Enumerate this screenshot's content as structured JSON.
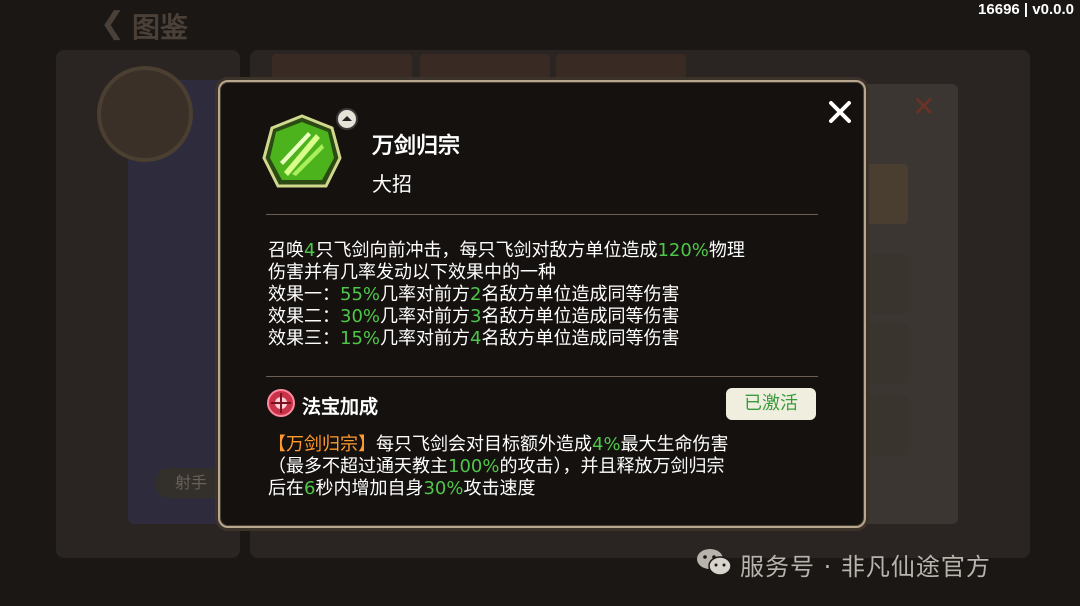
{
  "version_label": "16696 | v0.0.0",
  "background": {
    "page_title": "图鉴",
    "role_label": "射手"
  },
  "popup": {
    "skill": {
      "name": "万剑归宗",
      "type": "大招"
    },
    "description": {
      "line1": [
        {
          "t": "召唤",
          "c": "text"
        },
        {
          "t": "4",
          "c": "num"
        },
        {
          "t": "只飞剑向前冲击，每只飞剑对敌方单位造成",
          "c": "text"
        },
        {
          "t": "120%",
          "c": "num"
        },
        {
          "t": "物理",
          "c": "text"
        }
      ],
      "line2": [
        {
          "t": "伤害并有几率发动以下效果中的一种",
          "c": "text"
        }
      ],
      "line3": [
        {
          "t": "效果一：",
          "c": "text"
        },
        {
          "t": "55%",
          "c": "num"
        },
        {
          "t": "几率对前方",
          "c": "text"
        },
        {
          "t": "2",
          "c": "num"
        },
        {
          "t": "名敌方单位造成同等伤害",
          "c": "text"
        }
      ],
      "line4": [
        {
          "t": "效果二：",
          "c": "text"
        },
        {
          "t": "30%",
          "c": "num"
        },
        {
          "t": "几率对前方",
          "c": "text"
        },
        {
          "t": "3",
          "c": "num"
        },
        {
          "t": "名敌方单位造成同等伤害",
          "c": "text"
        }
      ],
      "line5": [
        {
          "t": "效果三：",
          "c": "text"
        },
        {
          "t": "15%",
          "c": "num"
        },
        {
          "t": "几率对前方",
          "c": "text"
        },
        {
          "t": "4",
          "c": "num"
        },
        {
          "t": "名敌方单位造成同等伤害",
          "c": "text"
        }
      ]
    },
    "treasure": {
      "title": "法宝加成",
      "status": "已激活",
      "line1": [
        {
          "t": "【万剑归宗】",
          "c": "hl"
        },
        {
          "t": "每只飞剑会对目标额外造成",
          "c": "text"
        },
        {
          "t": "4%",
          "c": "num"
        },
        {
          "t": "最大生命伤害",
          "c": "text"
        }
      ],
      "line2": [
        {
          "t": "（最多不超过通天教主",
          "c": "text"
        },
        {
          "t": "100%",
          "c": "num"
        },
        {
          "t": "的攻击），并且释放万剑归宗",
          "c": "text"
        }
      ],
      "line3": [
        {
          "t": "后在",
          "c": "text"
        },
        {
          "t": "6",
          "c": "num"
        },
        {
          "t": "秒内增加自身",
          "c": "text"
        },
        {
          "t": "30%",
          "c": "num"
        },
        {
          "t": "攻击速度",
          "c": "text"
        }
      ]
    },
    "icons": {
      "close": "close-icon",
      "skill": "sword-skill-icon",
      "upgrade": "chevron-up-icon",
      "treasure": "treasure-icon"
    },
    "colors": {
      "number": "#4fc64a",
      "highlight": "#ff9a2e",
      "active_badge_bg": "#f0efdf",
      "active_badge_text": "#3a9b3c"
    }
  },
  "watermark": {
    "text": "服务号 · 非凡仙途官方",
    "icon": "wechat-icon"
  }
}
